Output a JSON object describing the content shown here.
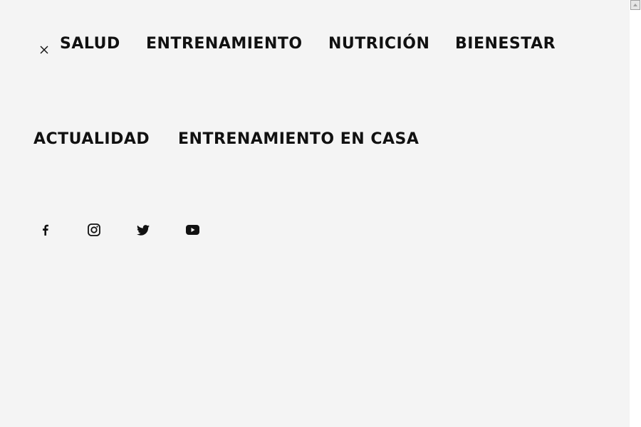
{
  "menu": {
    "close_icon": "close-icon",
    "items": [
      {
        "label": "SALUD"
      },
      {
        "label": "ENTRENAMIENTO"
      },
      {
        "label": "NUTRICIÓN"
      },
      {
        "label": "BIENESTAR"
      },
      {
        "label": "ACTUALIDAD"
      },
      {
        "label": "ENTRENAMIENTO EN CASA"
      }
    ]
  },
  "social": {
    "icons": [
      "facebook-icon",
      "instagram-icon",
      "twitter-icon",
      "youtube-icon"
    ]
  },
  "colors": {
    "overlay_bg": "#f4f4f4",
    "text": "#111111"
  }
}
